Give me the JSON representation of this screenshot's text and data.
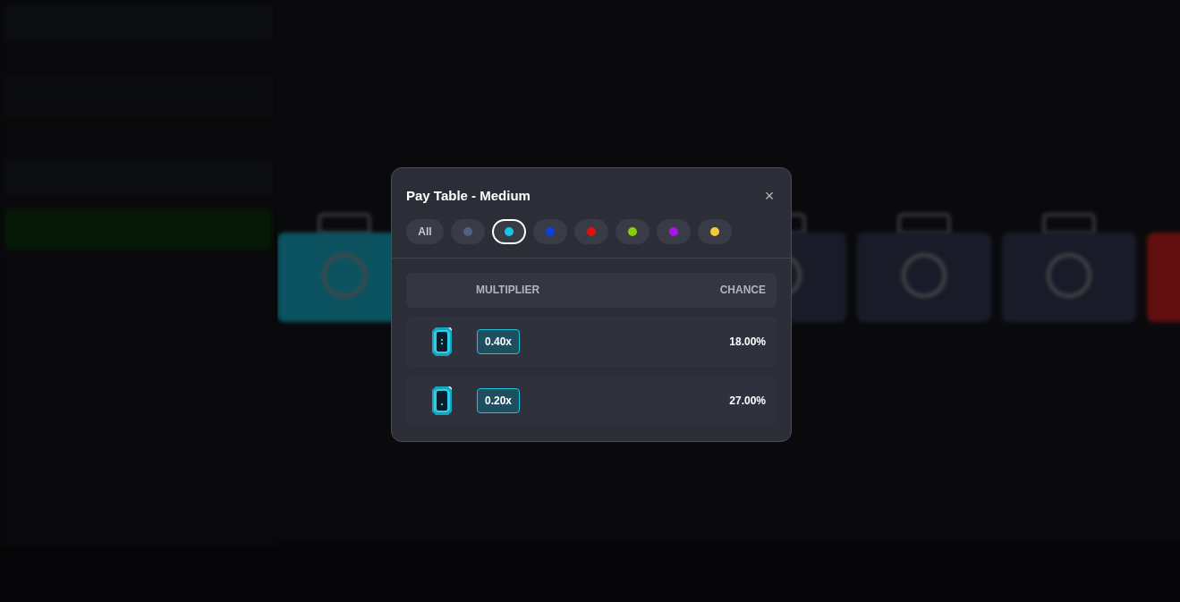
{
  "modal": {
    "title": "Pay Table - Medium",
    "close": "×",
    "filters": [
      {
        "kind": "all",
        "label": "All",
        "selected": false
      },
      {
        "kind": "color",
        "color": "#4f6282",
        "selected": false
      },
      {
        "kind": "color",
        "color": "#19c4e6",
        "selected": true
      },
      {
        "kind": "color",
        "color": "#1140e0",
        "selected": false
      },
      {
        "kind": "color",
        "color": "#e01010",
        "selected": false
      },
      {
        "kind": "color",
        "color": "#84d00c",
        "selected": false
      },
      {
        "kind": "color",
        "color": "#a915e8",
        "selected": false
      },
      {
        "kind": "color",
        "color": "#f5c93a",
        "selected": false
      }
    ],
    "table": {
      "columns": [
        "MULTIPLIER",
        "CHANCE"
      ],
      "rows": [
        {
          "multiplier": "0.40x",
          "chance": "18.00%"
        },
        {
          "multiplier": "0.20x",
          "chance": "27.00%"
        }
      ]
    }
  }
}
